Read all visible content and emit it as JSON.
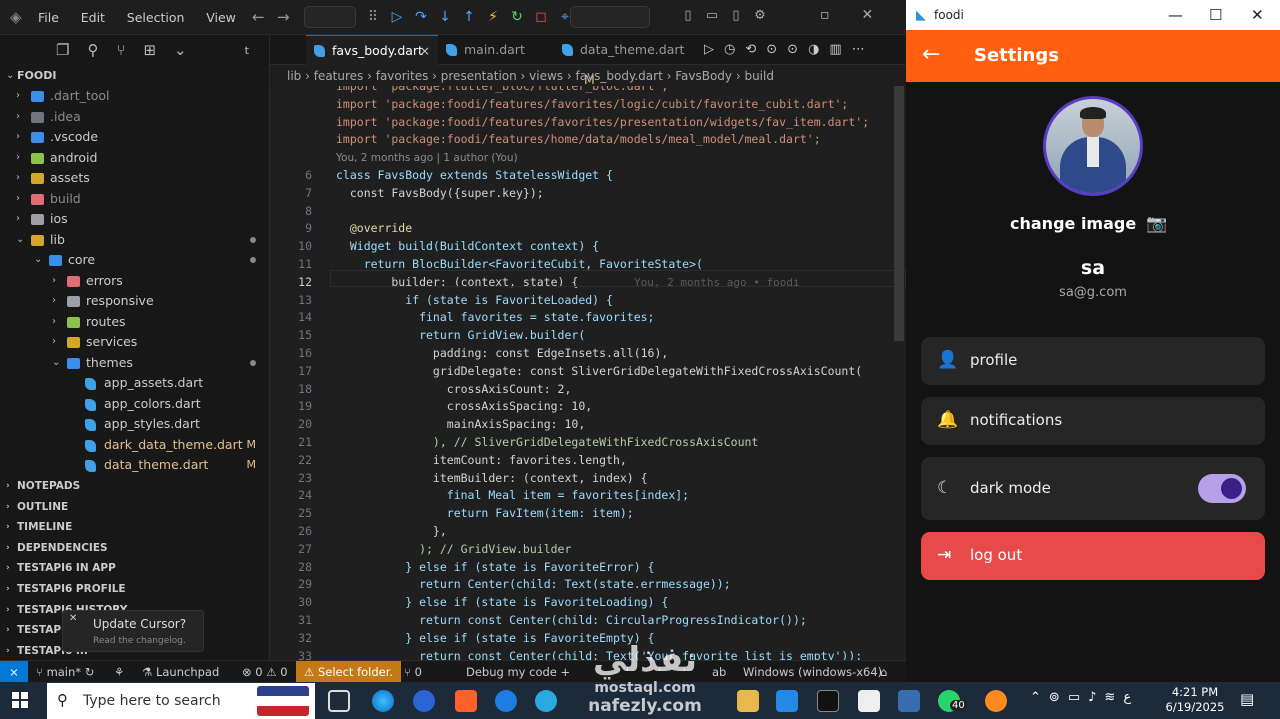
{
  "vscode": {
    "menu": [
      "File",
      "Edit",
      "Selection",
      "View"
    ],
    "tabs": [
      {
        "label": "favs_body.dart",
        "active": true,
        "close": "×"
      },
      {
        "label": "main.dart",
        "active": false
      },
      {
        "label": "data_theme.dart",
        "active": false,
        "mod": "M"
      }
    ],
    "breadcrumb": "lib › features › favorites › presentation › views › favs_body.dart › FavsBody › build",
    "explorer": {
      "root": "FOODI",
      "items": [
        {
          "label": ".dart_tool",
          "depth": 0,
          "color": "#3b8eea"
        },
        {
          "label": ".idea",
          "depth": 0,
          "color": "#6e7681"
        },
        {
          "label": ".vscode",
          "depth": 0,
          "color": "#3b8eea"
        },
        {
          "label": "android",
          "depth": 0,
          "color": "#8bc34a"
        },
        {
          "label": "assets",
          "depth": 0,
          "color": "#d4a72c"
        },
        {
          "label": "build",
          "depth": 0,
          "color": "#e06c75"
        },
        {
          "label": "ios",
          "depth": 0,
          "color": "#9aa0a6"
        },
        {
          "label": "lib",
          "depth": 0,
          "color": "#d4a72c",
          "open": true,
          "dot": true
        },
        {
          "label": "core",
          "depth": 1,
          "color": "#3b8eea",
          "open": true,
          "dot": true
        },
        {
          "label": "errors",
          "depth": 2,
          "color": "#e06c75"
        },
        {
          "label": "responsive",
          "depth": 2,
          "color": "#9aa0a6"
        },
        {
          "label": "routes",
          "depth": 2,
          "color": "#8bc34a"
        },
        {
          "label": "services",
          "depth": 2,
          "color": "#d4a72c"
        },
        {
          "label": "themes",
          "depth": 2,
          "color": "#3b8eea",
          "open": true,
          "dot": true
        },
        {
          "label": "app_assets.dart",
          "depth": 3,
          "color": "#40a0e8",
          "file": true
        },
        {
          "label": "app_colors.dart",
          "depth": 3,
          "color": "#40a0e8",
          "file": true
        },
        {
          "label": "app_styles.dart",
          "depth": 3,
          "color": "#40a0e8",
          "file": true
        },
        {
          "label": "dark_data_theme.dart",
          "depth": 3,
          "color": "#40a0e8",
          "file": true,
          "mod": "M"
        },
        {
          "label": "data_theme.dart",
          "depth": 3,
          "color": "#40a0e8",
          "file": true,
          "mod": "M"
        }
      ],
      "sections": [
        "NOTEPADS",
        "OUTLINE",
        "TIMELINE",
        "DEPENDENCIES",
        "TESTAPI6 IN APP",
        "TESTAPI6 PROFILE",
        "TESTAPI6 HISTORY",
        "TESTAPI6",
        "TESTAPI6 ..."
      ]
    },
    "toast": {
      "title": "Update Cursor?",
      "sub": "Read the changelog.",
      "close": "✕"
    },
    "blame": [
      "You, 2 months ago | 1 author (You)"
    ],
    "inline_blame": "You, 2 months ago • foodi",
    "code": [
      {
        "n": "",
        "t": "import 'package:flutter_bloc/flutter_bloc.dart';"
      },
      {
        "n": "",
        "t": "import 'package:foodi/features/favorites/logic/cubit/favorite_cubit.dart';"
      },
      {
        "n": "",
        "t": "import 'package:foodi/features/favorites/presentation/widgets/fav_item.dart';"
      },
      {
        "n": "",
        "t": "import 'package:foodi/features/home/data/models/meal_model/meal.dart';"
      },
      {
        "n": "6",
        "t": "class FavsBody extends StatelessWidget {"
      },
      {
        "n": "7",
        "t": "  const FavsBody({super.key});"
      },
      {
        "n": "8",
        "t": ""
      },
      {
        "n": "9",
        "t": "  @override"
      },
      {
        "n": "10",
        "t": "  Widget build(BuildContext context) {"
      },
      {
        "n": "11",
        "t": "    return BlocBuilder<FavoriteCubit, FavoriteState>("
      },
      {
        "n": "12",
        "t": "        builder: (context, state) {"
      },
      {
        "n": "13",
        "t": "          if (state is FavoriteLoaded) {"
      },
      {
        "n": "14",
        "t": "            final favorites = state.favorites;"
      },
      {
        "n": "15",
        "t": "            return GridView.builder("
      },
      {
        "n": "16",
        "t": "              padding: const EdgeInsets.all(16),"
      },
      {
        "n": "17",
        "t": "              gridDelegate: const SliverGridDelegateWithFixedCrossAxisCount("
      },
      {
        "n": "18",
        "t": "                crossAxisCount: 2,"
      },
      {
        "n": "19",
        "t": "                crossAxisSpacing: 10,"
      },
      {
        "n": "20",
        "t": "                mainAxisSpacing: 10,"
      },
      {
        "n": "21",
        "t": "              ), // SliverGridDelegateWithFixedCrossAxisCount"
      },
      {
        "n": "22",
        "t": "              itemCount: favorites.length,"
      },
      {
        "n": "23",
        "t": "              itemBuilder: (context, index) {"
      },
      {
        "n": "24",
        "t": "                final Meal item = favorites[index];"
      },
      {
        "n": "25",
        "t": "                return FavItem(item: item);"
      },
      {
        "n": "26",
        "t": "              },"
      },
      {
        "n": "27",
        "t": "            ); // GridView.builder"
      },
      {
        "n": "28",
        "t": "          } else if (state is FavoriteError) {"
      },
      {
        "n": "29",
        "t": "            return Center(child: Text(state.errmessage));"
      },
      {
        "n": "30",
        "t": "          } else if (state is FavoriteLoading) {"
      },
      {
        "n": "31",
        "t": "            return const Center(child: CircularProgressIndicator());"
      },
      {
        "n": "32",
        "t": "          } else if (state is FavoriteEmpty) {"
      },
      {
        "n": "33",
        "t": "            return const Center(child: Text('Your favorite list is empty'));"
      }
    ],
    "status": {
      "branch": "main*",
      "launchpad": "Launchpad",
      "problems": "⊗ 0 ⚠ 0",
      "select": "Select folder.",
      "zero": "0",
      "debug": "Debug my code +",
      "tab": "ab",
      "platform": "Windows (windows-x64)"
    }
  },
  "app": {
    "window_title": "foodi",
    "appbar_title": "Settings",
    "change_image": "change image",
    "name": "sa",
    "email": "sa@g.com",
    "menu": [
      {
        "label": "profile",
        "icon": "person-icon"
      },
      {
        "label": "notifications",
        "icon": "bell-icon"
      },
      {
        "label": "dark mode",
        "icon": "moon-icon",
        "toggle": true,
        "toggle_on": true
      },
      {
        "label": "log out",
        "icon": "logout-icon"
      }
    ],
    "accent": "#ff5f0f",
    "logout_color": "#e84a4a"
  },
  "taskbar": {
    "search_placeholder": "Type here to search",
    "time": "4:21 PM",
    "date": "6/19/2025",
    "lang": "ع",
    "whatsapp_badge": "40"
  },
  "watermark": {
    "line1": "نفذلي",
    "line2": "mostaql.com",
    "line3": "nafezly.com"
  }
}
